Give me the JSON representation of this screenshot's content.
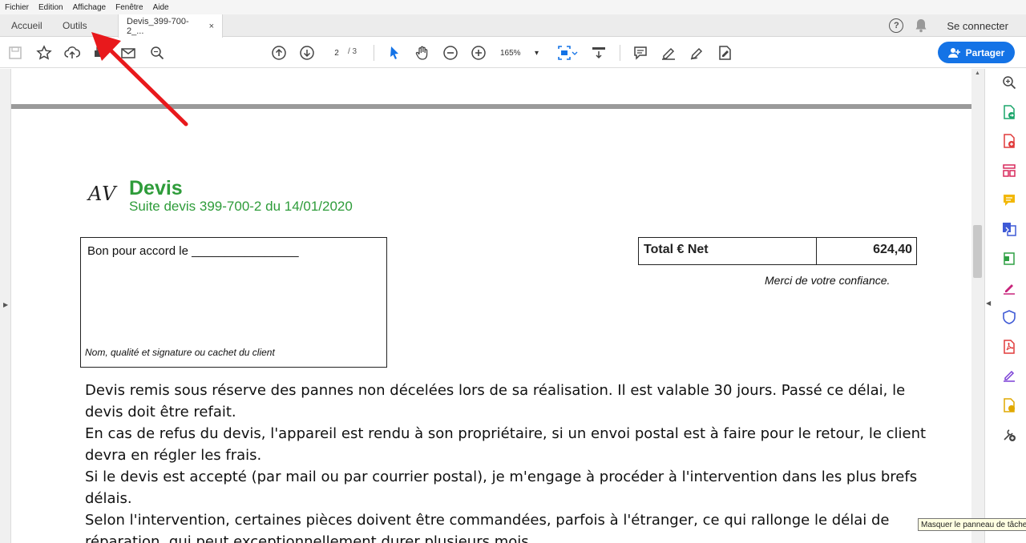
{
  "menu": {
    "items": [
      "Fichier",
      "Edition",
      "Affichage",
      "Fenêtre",
      "Aide"
    ]
  },
  "tabs": {
    "home": "Accueil",
    "tools": "Outils",
    "doc": "Devis_399-700-2_...",
    "close": "×"
  },
  "header": {
    "help_icon": "?",
    "signin": "Se connecter"
  },
  "toolbar": {
    "page_current": "2",
    "page_total": "/ 3",
    "zoom": "165%",
    "zoom_caret": "▾",
    "share_label": "Partager",
    "accent": "#1473e6"
  },
  "document": {
    "logo": "AV",
    "title": "Devis",
    "subtitle": "Suite devis 399-700-2 du 14/01/2020",
    "accord_label": "Bon pour accord le ________________",
    "accord_signature": "Nom, qualité et signature ou cachet du client",
    "total_label": "Total € Net",
    "total_value": "624,40",
    "thanks": "Merci de votre confiance.",
    "paragraphs": [
      "Devis remis sous réserve des pannes non décelées lors de sa réalisation. Il est valable 30 jours. Passé ce délai, le devis doit être refait.",
      "En cas de refus du devis, l'appareil est rendu à son propriétaire, si un envoi postal est à faire pour le retour, le client devra en régler les frais.",
      "Si le devis est  accepté (par mail ou par courrier postal), je m'engage à procéder à l'intervention dans les plus brefs délais.",
      "Selon l'intervention, certaines pièces doivent être commandées, parfois à l'étranger, ce qui rallonge le délai de réparation, qui peut exceptionnellement durer plusieurs mois."
    ],
    "title_color": "#2e9c3a"
  },
  "tooltip": "Masquer le panneau de tâches",
  "annotation": {
    "arrow_color": "#e8191c"
  }
}
